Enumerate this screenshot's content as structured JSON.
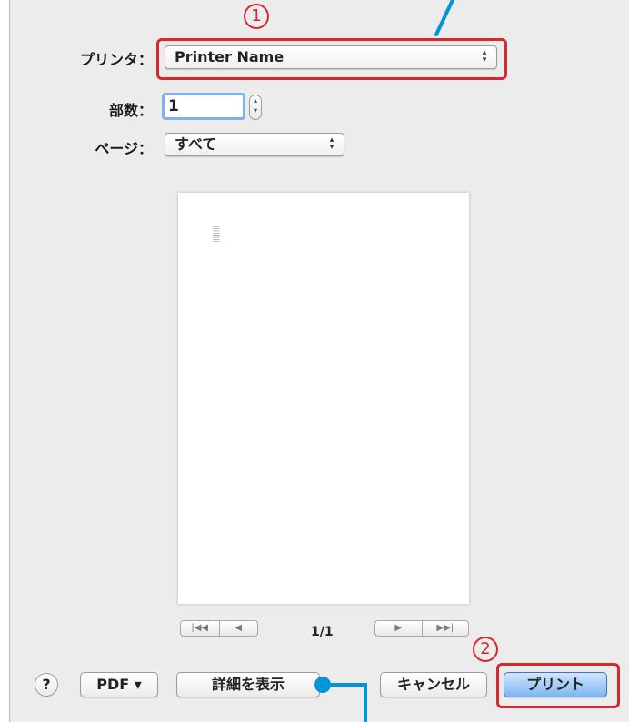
{
  "callouts": {
    "badge1": "1",
    "badge2": "2"
  },
  "printer": {
    "label": "プリンタ：",
    "value": "Printer Name"
  },
  "copies": {
    "label": "部数：",
    "value": "1"
  },
  "pages": {
    "label": "ページ：",
    "value": "すべて"
  },
  "preview": {
    "page_indicator": "1/1"
  },
  "buttons": {
    "help": "?",
    "pdf": "PDF ▾",
    "show_details": "詳細を表示",
    "cancel": "キャンセル",
    "print": "プリント"
  },
  "colors": {
    "highlight_red": "#d6282f",
    "callout_blue": "#0094d9"
  }
}
